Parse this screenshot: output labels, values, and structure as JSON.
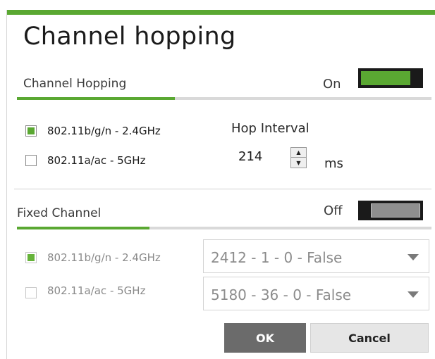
{
  "window": {
    "title": "Channel hopping"
  },
  "channel_hopping": {
    "section_label": "Channel Hopping",
    "toggle_label": "On",
    "toggle_state": "on",
    "bands": [
      {
        "label": "802.11b/g/n - 2.4GHz",
        "checked": true
      },
      {
        "label": "802.11a/ac - 5GHz",
        "checked": false
      }
    ],
    "hop_interval": {
      "label": "Hop Interval",
      "value": "214",
      "unit": "ms"
    }
  },
  "fixed_channel": {
    "section_label": "Fixed Channel",
    "toggle_label": "Off",
    "toggle_state": "off",
    "bands": [
      {
        "label": "802.11b/g/n - 2.4GHz",
        "checked": true,
        "select_value": "2412 - 1 - 0 - False"
      },
      {
        "label": "802.11a/ac - 5GHz",
        "checked": false,
        "select_value": "5180 - 36 - 0 - False"
      }
    ]
  },
  "buttons": {
    "ok": "OK",
    "cancel": "Cancel"
  },
  "colors": {
    "accent": "#5aa832",
    "toggle_off": "#8f8f8f",
    "ok_button": "#6b6b6b"
  }
}
